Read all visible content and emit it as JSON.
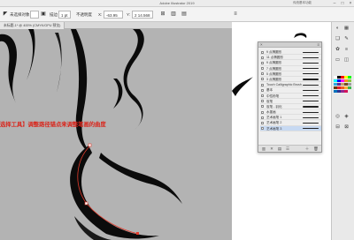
{
  "window": {
    "title": "Adobe Illustrator 2019",
    "workspace": "传统基本功能"
  },
  "control_bar": {
    "selection_label": "未选择对象",
    "stroke_label": "描边",
    "stroke_weight": "1 pt",
    "opacity_label": "不透明度",
    "x_label": "X:",
    "x_value": "-63.95 mm",
    "y_label": "Y:",
    "y_value": "2 14.568 mm"
  },
  "document": {
    "tab_label": "未标题-1* @ 400% (CMYK/GPU 预览)"
  },
  "annotation": "选择工具】调整路径锚点来调整笔画的曲度",
  "brush_panel": {
    "brushes": [
      {
        "name": "9 点椭圆形",
        "selected": false
      },
      {
        "name": "11 点椭圆形",
        "selected": false
      },
      {
        "name": "9 点椭圆形",
        "selected": false
      },
      {
        "name": "7 点椭圆形",
        "selected": false
      },
      {
        "name": "5 点椭圆形",
        "selected": false
      },
      {
        "name": "3 点椭圆形",
        "selected": false
      },
      {
        "name": "Touch Calligraphic Brush",
        "selected": false
      },
      {
        "name": "基本",
        "selected": false
      },
      {
        "name": "中性粉笔",
        "selected": false
      },
      {
        "name": "炭笔",
        "selected": false
      },
      {
        "name": "炭笔 - 羽化",
        "selected": false
      },
      {
        "name": "水墨画",
        "selected": false
      },
      {
        "name": "艺术画笔 1",
        "selected": false
      },
      {
        "name": "艺术画笔 2",
        "selected": false
      },
      {
        "name": "艺术画笔 3",
        "selected": true
      }
    ]
  },
  "colors": {
    "canvas": "#b3b3b3",
    "ink": "#0b0b0b",
    "annotation": "#d9261c",
    "panel_selection": "#c7d9f2",
    "path_highlight": "#e23b2c"
  },
  "swatches": [
    "#ffffff",
    "#000000",
    "#ff0000",
    "#ffff00",
    "#00ff00",
    "#00ffff",
    "#0000ff",
    "#ff00ff",
    "#f7931e",
    "#8cc63f",
    "#29abe2",
    "#662d91",
    "#c69c6d",
    "#754c24",
    "#9e9e9e",
    "#603813",
    "#ed1c24",
    "#f15a24",
    "#fbb03b",
    "#39b54a",
    "#0071bc",
    "#2e3192",
    "#93278f",
    "#d4145a"
  ]
}
